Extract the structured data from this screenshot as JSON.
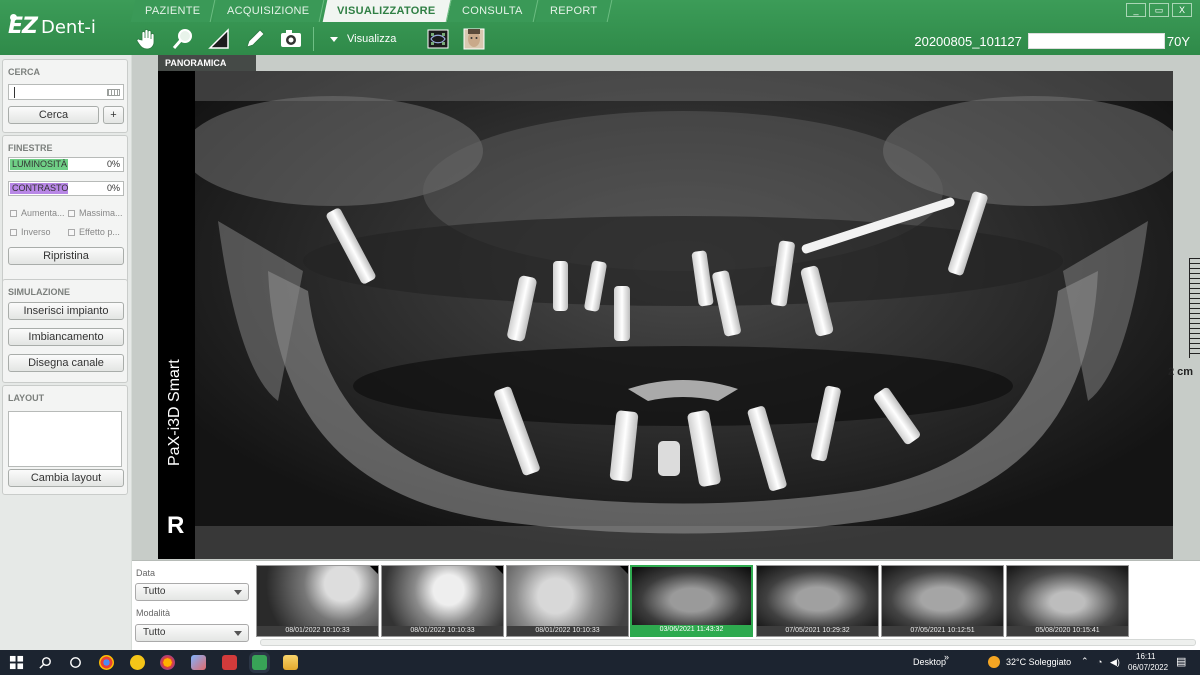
{
  "app": {
    "logo_ez": "EZ",
    "logo_rest": "Dent-i"
  },
  "tabs": [
    {
      "label": "PAZIENTE"
    },
    {
      "label": "ACQUISIZIONE"
    },
    {
      "label": "VISUALIZZATORE",
      "active": true
    },
    {
      "label": "CONSULTA"
    },
    {
      "label": "REPORT"
    }
  ],
  "toolbar": {
    "tools": [
      "hand-icon",
      "magnifier-icon",
      "ruler-icon",
      "pencil-icon",
      "capture-icon"
    ],
    "visualizza_label": "Visualizza",
    "view_icons": [
      "grid-view-icon",
      "face-view-icon"
    ]
  },
  "patient": {
    "id": "20200805_101127",
    "age": "70Y"
  },
  "window_controls": [
    "_",
    "▭",
    "X"
  ],
  "left": {
    "cerca": {
      "title": "CERCA",
      "search_value": "",
      "search_button": "Cerca",
      "plus_button": "+"
    },
    "finestre": {
      "title": "FINESTRE",
      "luminosita": {
        "label": "LUMINOSITÀ",
        "value": "0%",
        "color": "#6fcf86"
      },
      "contrasto": {
        "label": "CONTRASTO",
        "value": "0%",
        "color": "#b887e6"
      },
      "checks": [
        {
          "label": "Aumenta..."
        },
        {
          "label": "Massima..."
        },
        {
          "label": "Inverso"
        },
        {
          "label": "Effetto p..."
        }
      ],
      "reset_button": "Ripristina"
    },
    "simulazione": {
      "title": "SIMULAZIONE",
      "buttons": [
        "Inserisci impianto",
        "Imbiancamento",
        "Disegna canale"
      ]
    },
    "layout": {
      "title": "LAYOUT",
      "button": "Cambia layout"
    }
  },
  "viewer": {
    "tab_label": "PANORAMICA",
    "device_label": "PaX-i3D Smart",
    "side_marker": "R",
    "scale_label": "2 cm"
  },
  "filters": {
    "data_label": "Data",
    "data_value": "Tutto",
    "modalita_label": "Modalità",
    "modalita_value": "Tutto"
  },
  "thumbnails": [
    {
      "caption": "08/01/2022 10:10:33",
      "kind": "intraoral"
    },
    {
      "caption": "08/01/2022 10:10:33",
      "kind": "intraoral"
    },
    {
      "caption": "08/01/2022 10:10:33",
      "kind": "intraoral"
    },
    {
      "caption": "03/06/2021 11:43:32",
      "kind": "pano",
      "selected": true
    },
    {
      "caption": "07/05/2021 10:29:32",
      "kind": "pano"
    },
    {
      "caption": "07/05/2021 10:12:51",
      "kind": "pano"
    },
    {
      "caption": "05/08/2020 10:15:41",
      "kind": "pano"
    }
  ],
  "taskbar": {
    "desktop_label": "Desktop",
    "weather": "32°C  Soleggiato",
    "time": "16:11",
    "date": "06/07/2022",
    "apps": [
      "start-icon",
      "search-icon",
      "taskview-icon",
      "chrome-icon",
      "app-yellow-icon",
      "firefox-icon",
      "app-paint-icon",
      "app-red-icon",
      "ezdent-icon",
      "folder-icon"
    ]
  }
}
